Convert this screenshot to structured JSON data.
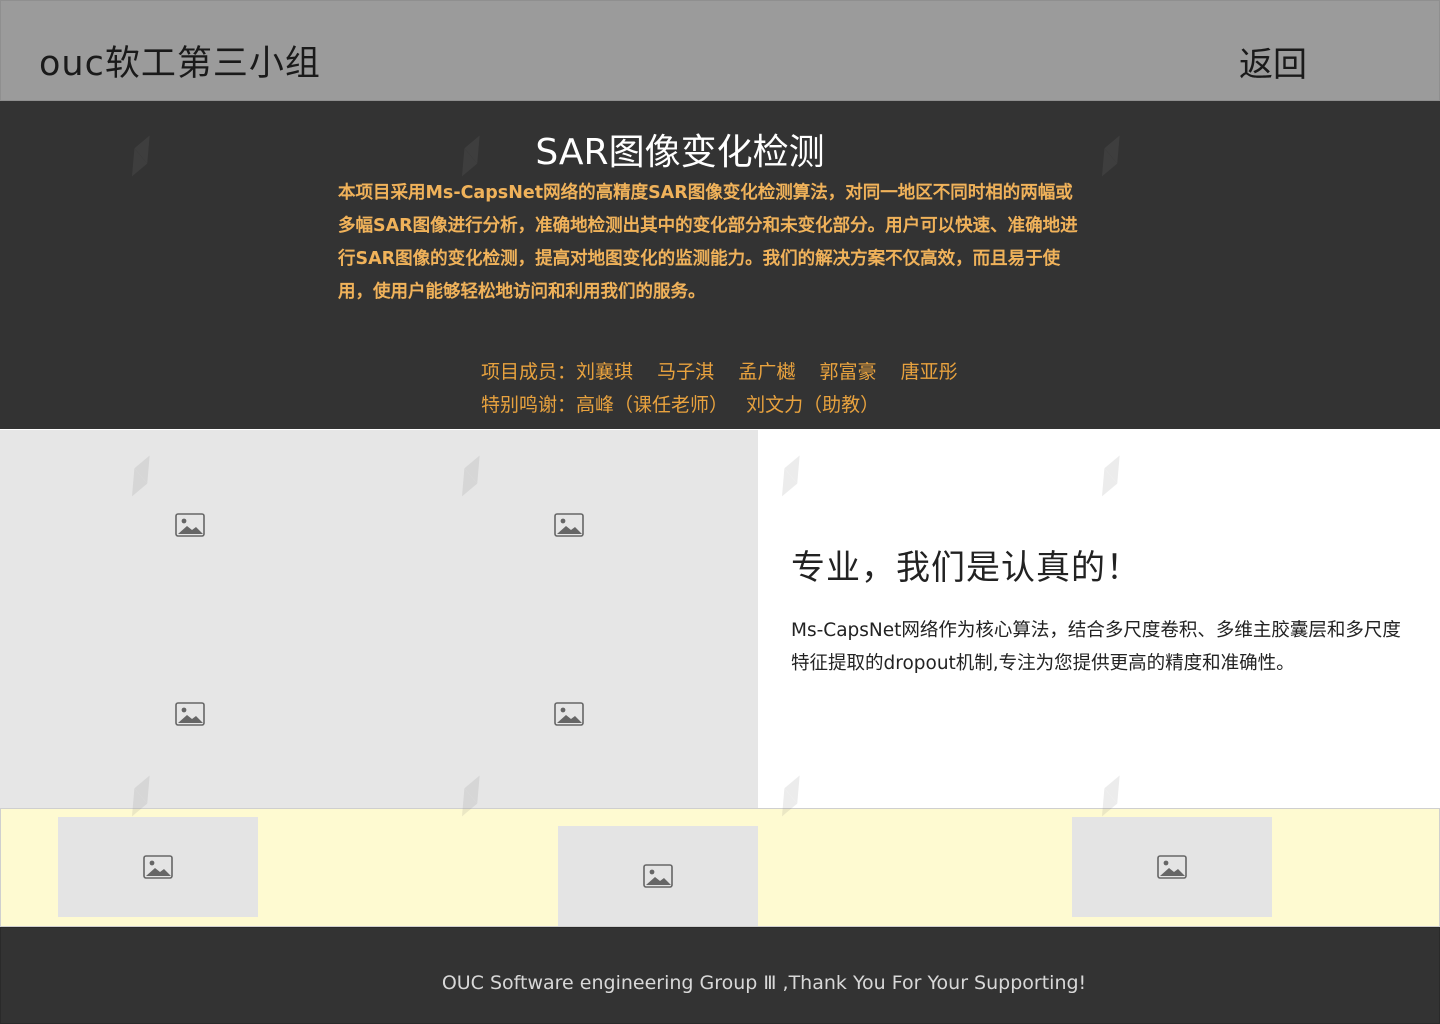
{
  "header": {
    "title": "ouc软工第三小组",
    "back_label": "返回"
  },
  "hero": {
    "title": "SAR图像变化检测",
    "description": "本项目采用Ms-CapsNet网络的高精度SAR图像变化检测算法，对同一地区不同时相的两幅或多幅SAR图像进行分析，准确地检测出其中的变化部分和未变化部分。用户可以快速、准确地进行SAR图像的变化检测，提高对地图变化的监测能力。我们的解决方案不仅高效，而且易于使用，使用户能够轻松地访问和利用我们的服务。",
    "members": "项目成员：刘襄琪    马子淇    孟广樾    郭富豪    唐亚彤",
    "thanks": "特别鸣谢：高峰（课任老师）   刘文力（助教）"
  },
  "info": {
    "title": "专业，我们是认真的！",
    "text": "Ms-CapsNet网络作为核心算法，结合多尺度卷积、多维主胶囊层和多尺度特征提取的dropout机制,专注为您提供更高的精度和准确性。"
  },
  "footer": {
    "text": "OUC Software engineering Group Ⅲ ,Thank You For Your Supporting!"
  },
  "icons": {
    "image_placeholder": "image-icon",
    "watermark": "watermark-logo"
  },
  "colors": {
    "header_bg": "#9b9b9b",
    "dark_bg": "#333333",
    "accent_orange": "#f0b25a",
    "gallery_bg": "#e6e6e6",
    "strip_bg": "#fefad1"
  }
}
